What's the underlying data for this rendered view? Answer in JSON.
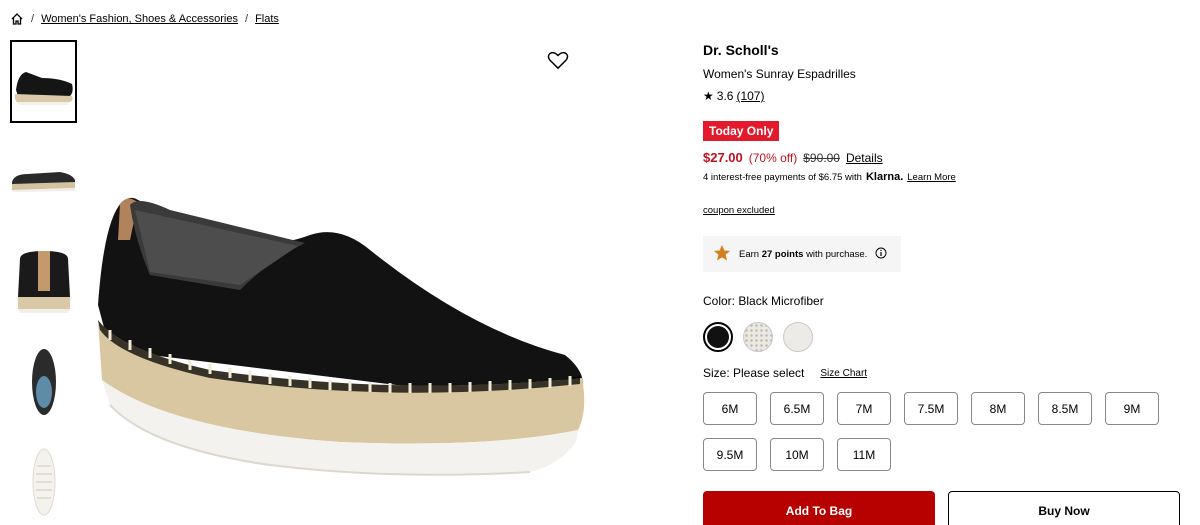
{
  "breadcrumb": {
    "home_icon": "home-icon",
    "items": [
      "Women's Fashion, Shoes & Accessories",
      "Flats"
    ]
  },
  "gallery": {
    "thumbnails": [
      "side-view",
      "profile-view",
      "heel-view",
      "top-view",
      "sole-view"
    ],
    "selected_index": 0,
    "wishlist_icon": "heart-outline-icon"
  },
  "product": {
    "brand": "Dr. Scholl's",
    "name": "Women's Sunray Espadrilles",
    "rating": "3.6",
    "reviews": "(107)",
    "star": "★"
  },
  "pricing": {
    "badge": "Today Only",
    "sale_price": "$27.00",
    "discount": "(70% off)",
    "original_price": "$90.00",
    "details_link": "Details",
    "klarna_text": "4 interest-free payments of $6.75 with",
    "klarna_brand": "Klarna.",
    "klarna_learn": "Learn More",
    "coupon": "coupon excluded"
  },
  "points": {
    "prefix": "Earn",
    "amount": "27 points",
    "suffix": "with purchase.",
    "star_icon": "star-icon",
    "info_icon": "info-icon"
  },
  "colors": {
    "label": "Color: Black Microfiber",
    "swatches": [
      {
        "name": "Black Microfiber",
        "color": "#111111"
      },
      {
        "name": "Perforated White",
        "color": "#e4e2dd"
      },
      {
        "name": "White",
        "color": "#ecebe7"
      }
    ]
  },
  "sizes": {
    "label": "Size: Please select",
    "chart_link": "Size Chart",
    "options": [
      "6M",
      "6.5M",
      "7M",
      "7.5M",
      "8M",
      "8.5M",
      "9M",
      "9.5M",
      "10M",
      "11M"
    ]
  },
  "actions": {
    "add_to_bag": "Add To Bag",
    "buy_now": "Buy Now"
  },
  "colors_theme": {
    "sale_red": "#c0111f",
    "badge_red": "#e21a2c",
    "cta_red": "#b70000",
    "points_star": "#d4801f"
  }
}
